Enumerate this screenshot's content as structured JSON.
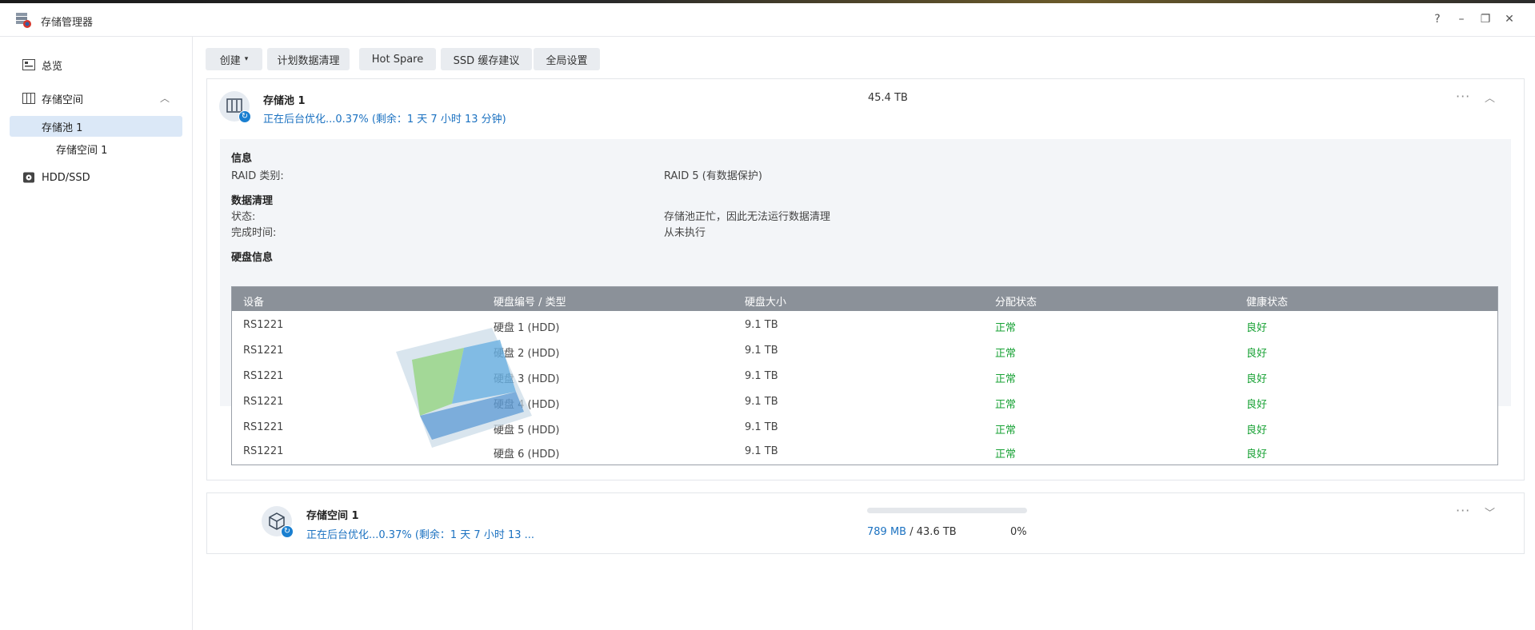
{
  "window": {
    "title": "存储管理器",
    "controls": [
      "?",
      "–",
      "❐",
      "✕"
    ]
  },
  "sidebar": {
    "items": [
      {
        "label": "总览",
        "icon": "overview-icon"
      },
      {
        "label": "存储空间",
        "icon": "storage-icon"
      },
      {
        "label": "存储池 1"
      },
      {
        "label": "存储空间 1"
      },
      {
        "label": "HDD/SSD",
        "icon": "disk-icon"
      }
    ]
  },
  "toolbar": {
    "create_label": "创建",
    "schedule_label": "计划数据清理",
    "hotspare_label": "Hot Spare",
    "ssd_label": "SSD 缓存建议",
    "global_label": "全局设置"
  },
  "pool": {
    "name": "存储池 1",
    "status": "正在后台优化...0.37% (剩余：1 天 7 小时 13 分钟)",
    "capacity": "45.4 TB",
    "info_title": "信息",
    "raid_key": "RAID 类别:",
    "raid_value": "RAID 5 (有数据保护)",
    "scrub_title": "数据清理",
    "state_key": "状态:",
    "state_value": "存储池正忙，因此无法运行数据清理",
    "done_key": "完成时间:",
    "done_value": "从未执行",
    "disk_title": "硬盘信息"
  },
  "disk_table": {
    "headers": [
      "设备",
      "硬盘编号 / 类型",
      "硬盘大小",
      "分配状态",
      "健康状态"
    ],
    "rows": [
      {
        "device": "RS1221",
        "disk": "硬盘 1 (HDD)",
        "size": "9.1 TB",
        "alloc": "正常",
        "health": "良好"
      },
      {
        "device": "RS1221",
        "disk": "硬盘 2 (HDD)",
        "size": "9.1 TB",
        "alloc": "正常",
        "health": "良好"
      },
      {
        "device": "RS1221",
        "disk": "硬盘 3 (HDD)",
        "size": "9.1 TB",
        "alloc": "正常",
        "health": "良好"
      },
      {
        "device": "RS1221",
        "disk": "硬盘 4 (HDD)",
        "size": "9.1 TB",
        "alloc": "正常",
        "health": "良好"
      },
      {
        "device": "RS1221",
        "disk": "硬盘 5 (HDD)",
        "size": "9.1 TB",
        "alloc": "正常",
        "health": "良好"
      },
      {
        "device": "RS1221",
        "disk": "硬盘 6 (HDD)",
        "size": "9.1 TB",
        "alloc": "正常",
        "health": "良好"
      }
    ]
  },
  "volume": {
    "name": "存储空间 1",
    "status": "正在后台优化...0.37% (剩余：1 天 7 小时 13 ...",
    "used": "789 MB",
    "separator": "/",
    "total": "43.6 TB",
    "percent": "0%",
    "usage_fraction": 0
  },
  "colors": {
    "accent": "#1c72c1",
    "ok": "#18a235",
    "table_header": "#8b9199"
  }
}
